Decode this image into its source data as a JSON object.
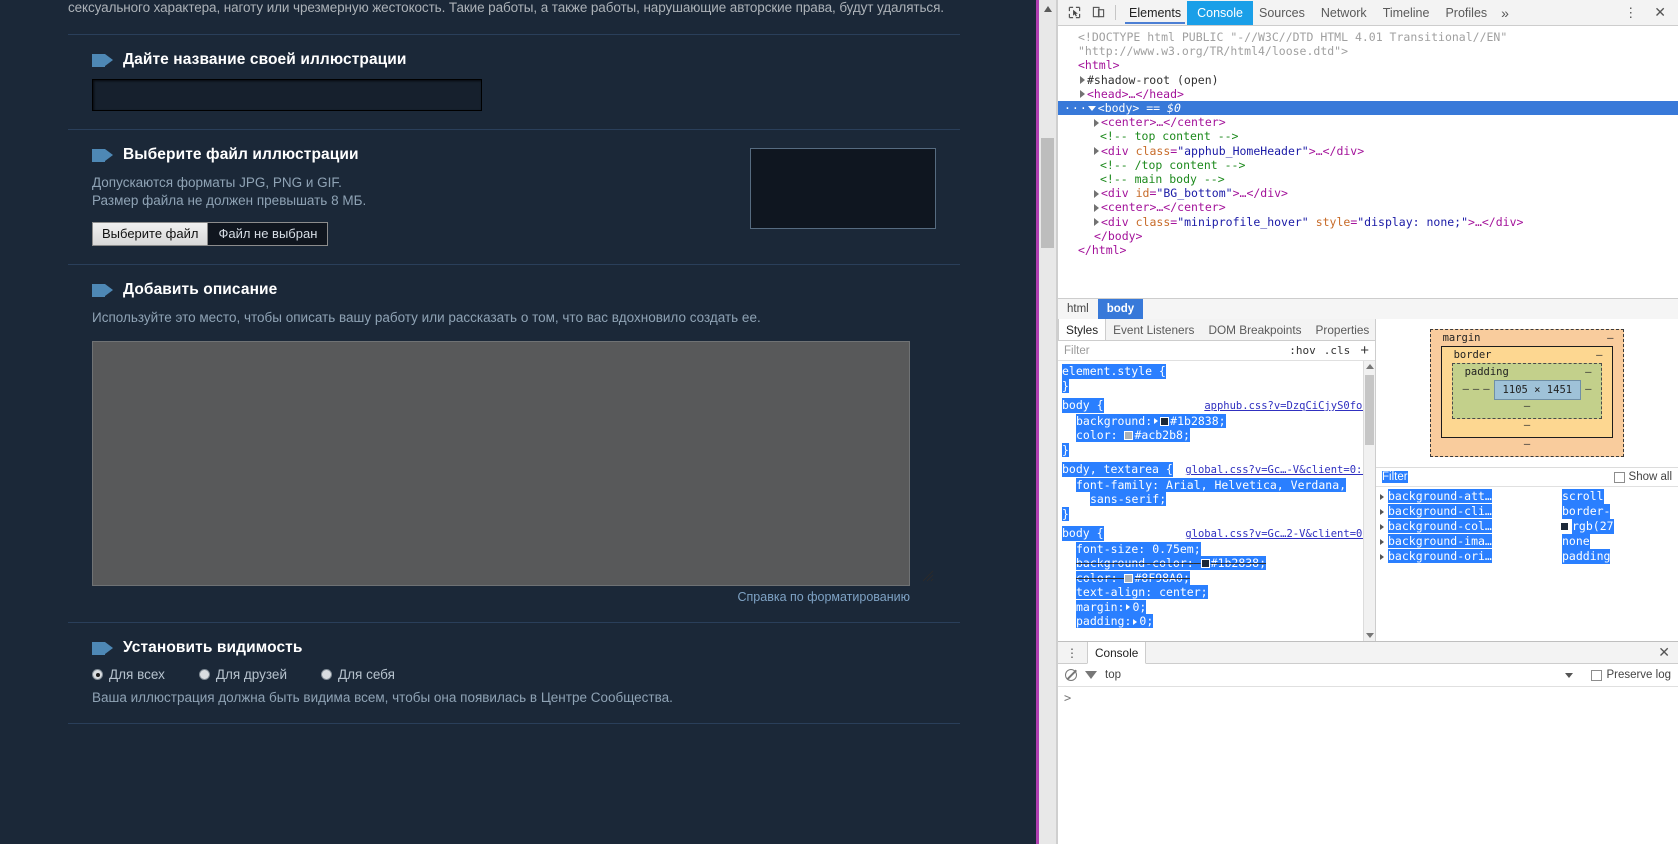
{
  "page": {
    "rules_text": "сексуального характера, наготу или чрезмерную жестокость. Такие работы, а также работы, нарушающие авторские права, будут удаляться.",
    "sections": [
      {
        "title": "Дайте название своей иллюстрации",
        "input_value": "",
        "input_placeholder": ""
      },
      {
        "title": "Выберите файл иллюстрации",
        "desc_line1": "Допускаются форматы JPG, PNG и GIF.",
        "desc_line2": "Размер файла не должен превышать 8 МБ.",
        "file_button": "Выберите файл",
        "file_status": "Файл не выбран"
      },
      {
        "title": "Добавить описание",
        "desc": "Используйте это место, чтобы описать вашу работу или рассказать о том, что вас вдохновило создать ее.",
        "textarea_value": "",
        "format_help": "Справка по форматированию"
      },
      {
        "title": "Установить видимость",
        "options": [
          {
            "label": "Для всех",
            "checked": true
          },
          {
            "label": "Для друзей",
            "checked": false
          },
          {
            "label": "Для себя",
            "checked": false
          }
        ],
        "note": "Ваша иллюстрация должна быть видима всем, чтобы она появилась в Центре Сообщества."
      }
    ]
  },
  "devtools": {
    "toolbar": {
      "inspect_icon": "inspect-cursor-icon",
      "device_icon": "device-toolbar-icon",
      "tabs": [
        {
          "label": "Elements",
          "state": "active"
        },
        {
          "label": "Console",
          "state": "selected"
        },
        {
          "label": "Sources",
          "state": "normal"
        },
        {
          "label": "Network",
          "state": "normal"
        },
        {
          "label": "Timeline",
          "state": "normal"
        },
        {
          "label": "Profiles",
          "state": "normal"
        }
      ],
      "more_tabs": "»",
      "kebab": "⋮",
      "close": "✕"
    },
    "dom": {
      "lines": [
        {
          "indent": 0,
          "type": "doctype",
          "text": "<!DOCTYPE html PUBLIC \"-//W3C//DTD HTML 4.01 Transitional//EN\""
        },
        {
          "indent": 0,
          "type": "doctype",
          "text": "\"http://www.w3.org/TR/html4/loose.dtd\">"
        },
        {
          "indent": 0,
          "type": "tag",
          "text": "<html>"
        },
        {
          "indent": 1,
          "type": "shadow",
          "text": "#shadow-root (open)",
          "arrow": true
        },
        {
          "indent": 1,
          "type": "tag",
          "text": "<head>…</head>",
          "arrow": true
        },
        {
          "indent": 1,
          "type": "selected",
          "text": "<body>",
          "suffix": " == $0",
          "arrow": "down"
        },
        {
          "indent": 2,
          "type": "tag",
          "text": "<center>…</center>",
          "arrow": true
        },
        {
          "indent": 2,
          "type": "comment",
          "text": "<!-- top content -->"
        },
        {
          "indent": 2,
          "type": "tag_attr",
          "tag_open": "<div ",
          "attr": "class",
          "value": "\"apphub_HomeHeader\"",
          "tag_close": ">…</div>",
          "arrow": true
        },
        {
          "indent": 2,
          "type": "comment",
          "text": "<!-- /top content -->"
        },
        {
          "indent": 2,
          "type": "comment",
          "text": "<!-- main body -->"
        },
        {
          "indent": 2,
          "type": "tag_attr",
          "tag_open": "<div ",
          "attr": "id",
          "value": "\"BG_bottom\"",
          "tag_close": ">…</div>",
          "arrow": true
        },
        {
          "indent": 2,
          "type": "tag",
          "text": "<center>…</center>",
          "arrow": true
        },
        {
          "indent": 2,
          "type": "tag_attr2",
          "tag_open": "<div ",
          "attr": "class",
          "value": "\"miniprofile_hover\"",
          "attr2": "style",
          "value2": "\"display: none;\"",
          "tag_close": ">…</div>",
          "arrow": true
        },
        {
          "indent": 2,
          "type": "tag",
          "text": "</body>"
        },
        {
          "indent": 0,
          "type": "tag",
          "text": "</html>"
        }
      ]
    },
    "breadcrumb": [
      {
        "label": "html",
        "active": false
      },
      {
        "label": "body",
        "active": true
      }
    ],
    "sidebar_tabs": [
      {
        "label": "Styles",
        "active": true
      },
      {
        "label": "Event Listeners",
        "active": false
      },
      {
        "label": "DOM Breakpoints",
        "active": false
      },
      {
        "label": "Properties",
        "active": false
      }
    ],
    "styles_filter": {
      "placeholder": "Filter",
      "hov": ":hov",
      "cls": ".cls",
      "add": "+"
    },
    "style_rules": [
      {
        "selector": "element.style {",
        "source": "",
        "props": [],
        "close": "}"
      },
      {
        "selector": "body {",
        "source": "apphub.css?v=DzqCiCjyS0fo:2",
        "props": [
          {
            "name": "background:",
            "value": "#1b2838;",
            "swatch": "#1b2838",
            "expandable": true,
            "struck": false
          },
          {
            "name": "color:",
            "value": "#acb2b8;",
            "swatch": "#acb2b8",
            "expandable": false,
            "struck": false
          }
        ],
        "close": "}"
      },
      {
        "selector": "body, textarea {",
        "source": "global.css?v=Gc…-V&client=0:14",
        "props": [
          {
            "name": "font-family:",
            "value": "Arial, Helvetica, Verdana,",
            "value2": "sans-serif;",
            "swatch": "",
            "expandable": false,
            "struck": false
          }
        ],
        "close": "}"
      },
      {
        "selector": "body {",
        "source": "global.css?v=Gc…2-V&client=0:3",
        "props": [
          {
            "name": "font-size:",
            "value": "0.75em;",
            "swatch": "",
            "expandable": false,
            "struck": false
          },
          {
            "name": "background-color:",
            "value": "#1b2838;",
            "swatch": "#1b2838",
            "expandable": false,
            "struck": true
          },
          {
            "name": "color:",
            "value": "#8F98A0;",
            "swatch": "#8F98A0",
            "expandable": false,
            "struck": true
          },
          {
            "name": "text-align:",
            "value": "center;",
            "swatch": "",
            "expandable": false,
            "struck": false
          },
          {
            "name": "margin:",
            "value": "0;",
            "swatch": "",
            "expandable": true,
            "struck": false
          },
          {
            "name": "padding:",
            "value": "0;",
            "swatch": "",
            "expandable": true,
            "struck": false
          }
        ],
        "close": ""
      }
    ],
    "box_model": {
      "margin_label": "margin",
      "border_label": "border",
      "padding_label": "padding",
      "content": "1105 × 1451",
      "dash": "–"
    },
    "computed": {
      "filter_placeholder": "Filter",
      "show_all_label": "Show all",
      "rows": [
        {
          "name": "background-att…",
          "value": "scroll"
        },
        {
          "name": "background-cli…",
          "value": "border-"
        },
        {
          "name": "background-col…",
          "value": "rgb(27"
        },
        {
          "name": "background-ima…",
          "value": "none"
        },
        {
          "name": "background-ori…",
          "value": "padding"
        }
      ]
    },
    "drawer": {
      "tab": "Console",
      "kebab": "⋮",
      "close": "✕",
      "clear_icon": "clear-console-icon",
      "filter_icon": "filter-icon",
      "context": "top",
      "preserve_log": "Preserve log",
      "prompt": ">"
    }
  }
}
